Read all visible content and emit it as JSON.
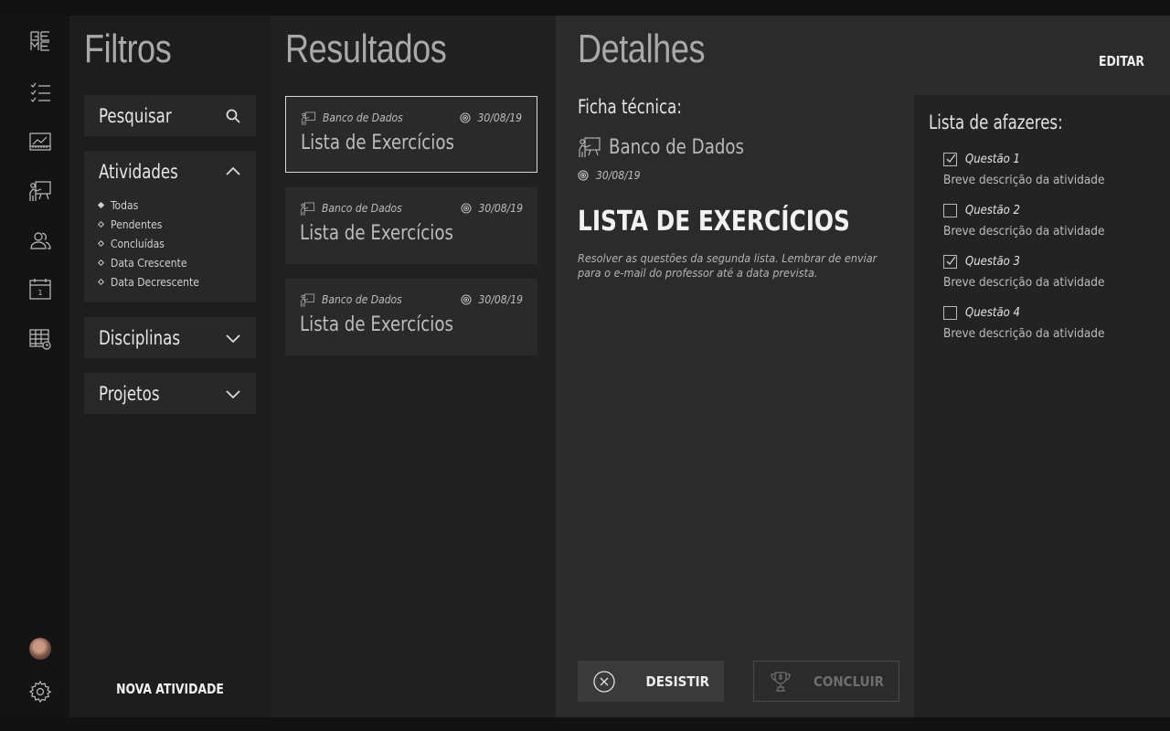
{
  "rail": {
    "icons": [
      "game-logo-icon",
      "checklist-icon",
      "chart-icon",
      "teacher-board-icon",
      "people-icon",
      "calendar-icon",
      "table-clock-icon"
    ],
    "calendar_day": "1"
  },
  "filters": {
    "title": "Filtros",
    "search_label": "Pesquisar",
    "activities": {
      "label": "Atividades",
      "options": [
        "Todas",
        "Pendentes",
        "Concluídas",
        "Data Crescente",
        "Data Decrescente"
      ],
      "selected": "Todas"
    },
    "disciplines_label": "Disciplinas",
    "projects_label": "Projetos",
    "new_activity_label": "NOVA ATIVIDADE"
  },
  "results": {
    "title": "Resultados",
    "cards": [
      {
        "subject": "Banco de Dados",
        "date": "30/08/19",
        "title": "Lista de Exercícios",
        "active": true
      },
      {
        "subject": "Banco de Dados",
        "date": "30/08/19",
        "title": "Lista de Exercícios",
        "active": false
      },
      {
        "subject": "Banco de Dados",
        "date": "30/08/19",
        "title": "Lista de Exercícios",
        "active": false
      }
    ]
  },
  "details": {
    "title": "Detalhes",
    "edit_label": "EDITAR",
    "ficha_label": "Ficha técnica:",
    "subject": "Banco de Dados",
    "date": "30/08/19",
    "activity_title": "LISTA DE EXERCÍCIOS",
    "description": "Resolver as questões da segunda lista. Lembrar de enviar para o e-mail do professor até a data prevista.",
    "give_up_label": "DESISTIR",
    "complete_label": "CONCLUIR"
  },
  "todo": {
    "title": "Lista de afazeres:",
    "items": [
      {
        "label": "Questão 1",
        "desc": "Breve descrição da atividade",
        "checked": true
      },
      {
        "label": "Questão 2",
        "desc": "Breve descrição da atividade",
        "checked": false
      },
      {
        "label": "Questão 3",
        "desc": "Breve descrição da atividade",
        "checked": true
      },
      {
        "label": "Questão 4",
        "desc": "Breve descrição da atividade",
        "checked": false
      }
    ]
  },
  "colors": {
    "background": "#121212",
    "rail": "#141414",
    "filters_bg": "#1d1d1d",
    "results_bg": "#212121",
    "details_bg": "#2b2b2b",
    "todo_bg": "#232323",
    "panel_bg": "#282828"
  }
}
